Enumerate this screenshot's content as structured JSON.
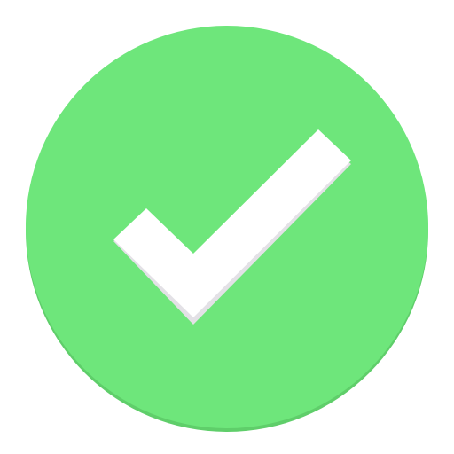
{
  "icon": {
    "name": "check-circle-icon",
    "colors": {
      "circle": "#6ee67b",
      "circle_shadow": "#5fce6a",
      "check": "#ffffff",
      "check_shadow": "#e3e1e6"
    }
  }
}
